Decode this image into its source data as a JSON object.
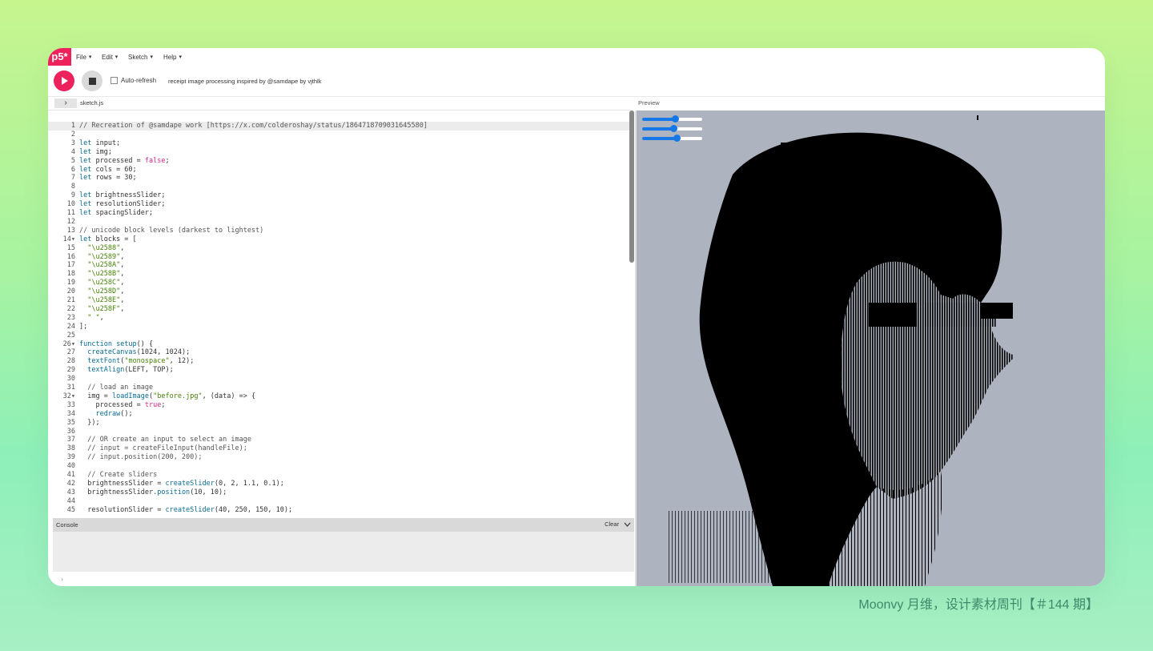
{
  "menubar": {
    "logo": "p5*",
    "items": [
      {
        "label": "File",
        "caret": "▾"
      },
      {
        "label": "Edit",
        "caret": "▾"
      },
      {
        "label": "Sketch",
        "caret": "▾"
      },
      {
        "label": "Help",
        "caret": "▾"
      }
    ]
  },
  "toolbar": {
    "auto_refresh_label": "Auto-refresh",
    "auto_refresh_checked": false,
    "sketch_title": "receipt image processing inspired by @samdape  by vjthlk"
  },
  "editor": {
    "tab_toggle_icon": "›",
    "file_name": "sketch.js",
    "lines": [
      "// Recreation of @samdape work [https://x.com/colderoshay/status/1864718709031645580]",
      "",
      "let input;",
      "let img;",
      "let processed = false;",
      "let cols = 60;",
      "let rows = 30;",
      "",
      "let brightnessSlider;",
      "let resolutionSlider;",
      "let spacingSlider;",
      "",
      "// unicode block levels (darkest to lightest)",
      "let blocks = [",
      "  \"\\u2588\",",
      "  \"\\u2589\",",
      "  \"\\u258A\",",
      "  \"\\u258B\",",
      "  \"\\u258C\",",
      "  \"\\u258D\",",
      "  \"\\u258E\",",
      "  \"\\u258F\",",
      "  \" \",",
      "];",
      "",
      "function setup() {",
      "  createCanvas(1024, 1024);",
      "  textFont(\"monospace\", 12);",
      "  textAlign(LEFT, TOP);",
      "",
      "  // load an image",
      "  img = loadImage(\"before.jpg\", (data) => {",
      "    processed = true;",
      "    redraw();",
      "  });",
      "",
      "  // OR create an input to select an image",
      "  // input = createFileInput(handleFile);",
      "  // input.position(200, 200);",
      "",
      "  // Create sliders",
      "  brightnessSlider = createSlider(0, 2, 1.1, 0.1);",
      "  brightnessSlider.position(10, 10);",
      "",
      "  resolutionSlider = createSlider(40, 250, 150, 10);"
    ],
    "folded_lines": [
      14,
      26,
      32
    ]
  },
  "preview": {
    "label": "Preview",
    "sliders": [
      {
        "name": "brightness",
        "value": 1.1,
        "min": 0,
        "max": 2
      },
      {
        "name": "resolution",
        "value": 150,
        "min": 40,
        "max": 250
      },
      {
        "name": "spacing",
        "value": 0.58,
        "min": 0,
        "max": 1
      }
    ],
    "accent": "#1677e6"
  },
  "console": {
    "label": "Console",
    "clear_label": "Clear",
    "collapse_icon": "chevron-down-icon",
    "prompt": "›"
  },
  "watermark": "Moonvy 月维，设计素材周刊【＃144 期】",
  "colors": {
    "p5_pink": "#ed225d",
    "keyword": "#0b6c95",
    "string": "#47820b",
    "boolean": "#d52889",
    "preview_bg": "#aeb4bf"
  }
}
